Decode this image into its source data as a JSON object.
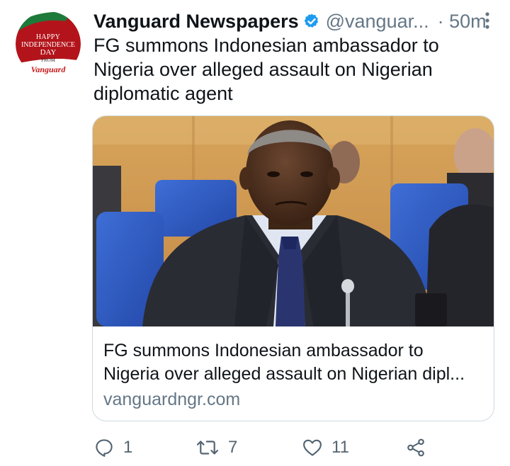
{
  "account": {
    "name": "Vanguard Newspapers",
    "handle": "@vanguar...",
    "time": "· 50m",
    "avatar_text": {
      "line1": "HAPPY",
      "line2": "INDEPENDENCE",
      "line3": "DAY",
      "line4": "FROM",
      "brand": "Vanguard"
    },
    "verified_color": "#1d9bf0"
  },
  "tweet": {
    "text": "FG summons Indonesian ambassador to Nigeria over alleged assault on Nigerian diplomatic agent"
  },
  "card": {
    "title_line1": "FG summons Indonesian ambassador to",
    "title_line2": "Nigeria over alleged assault on Nigerian dipl...",
    "domain": "vanguardngr.com"
  },
  "actions": {
    "reply_count": "1",
    "retweet_count": "7",
    "like_count": "11"
  },
  "colors": {
    "text": "#0f1419",
    "secondary": "#657786",
    "border": "#cfd9de",
    "brand_red": "#c81a1a"
  }
}
